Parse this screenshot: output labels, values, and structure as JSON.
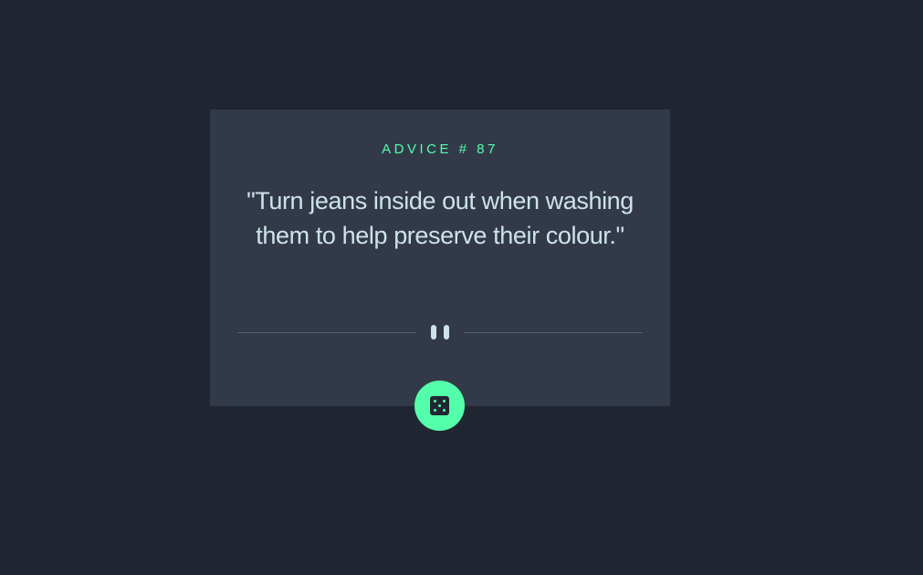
{
  "advice": {
    "id_label": "ADVICE # 87",
    "quote": "\"Turn jeans inside out when washing them to help preserve their colour.\""
  },
  "icons": {
    "divider": "pause-icon",
    "button": "dice-icon"
  },
  "colors": {
    "background": "#202631",
    "card": "#323a49",
    "accent": "#53ffaa",
    "text": "#cee3e9",
    "divider": "#4f5d74"
  }
}
